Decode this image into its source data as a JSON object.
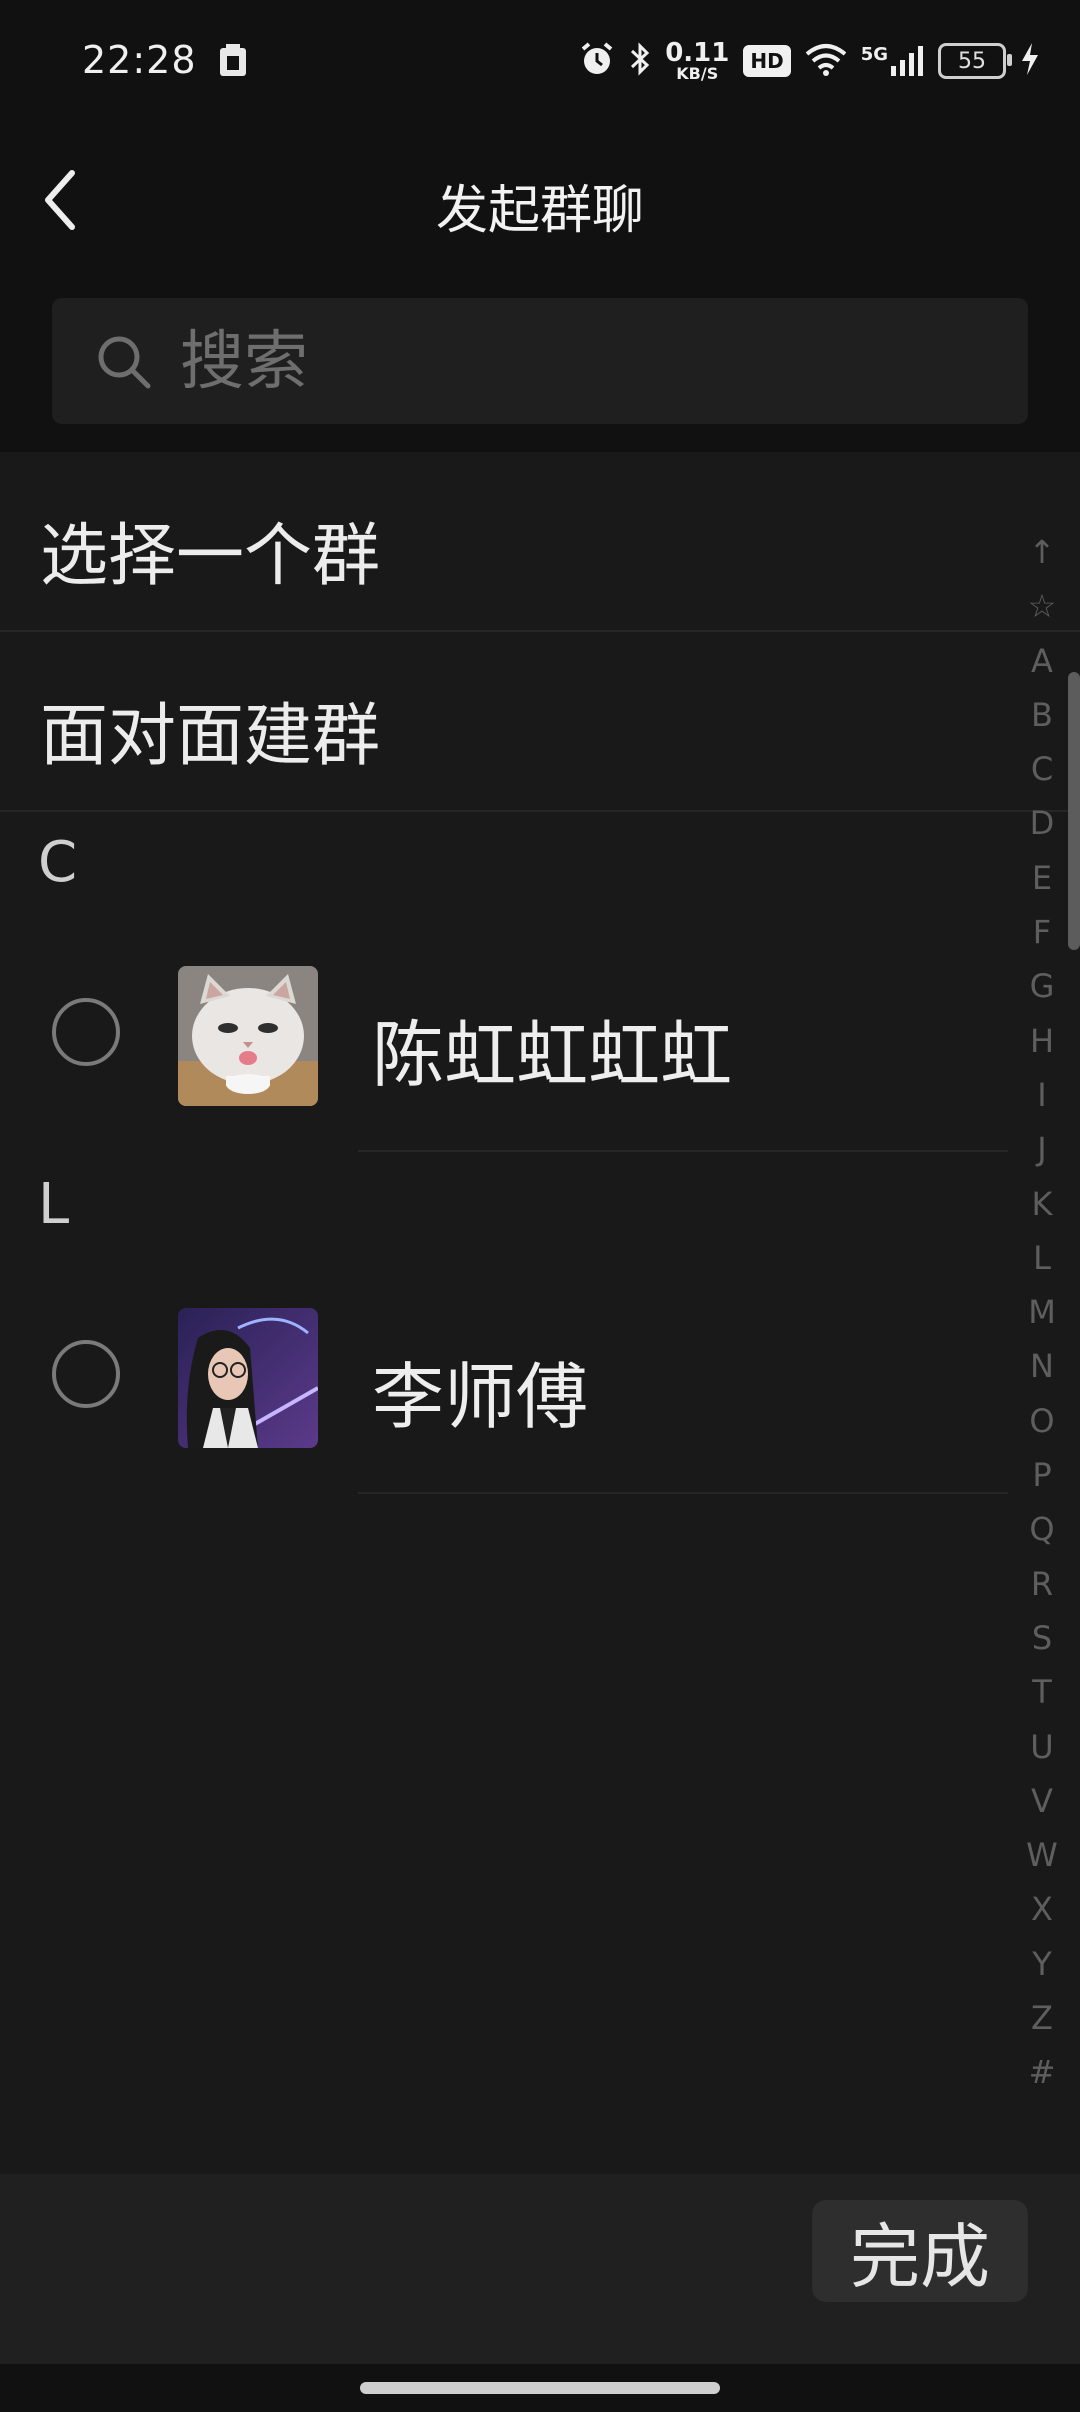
{
  "status_bar": {
    "time": "22:28",
    "net_speed_value": "0.11",
    "net_speed_unit": "KB/S",
    "hd_label": "HD",
    "network_type": "5G",
    "battery": "55",
    "icons": [
      "alarm-icon",
      "bluetooth-icon",
      "wifi-icon",
      "signal-icon",
      "charging-icon"
    ]
  },
  "header": {
    "title": "发起群聊",
    "back_icon": "chevron-left-icon"
  },
  "search": {
    "placeholder": "搜索",
    "value": ""
  },
  "options": [
    {
      "label": "选择一个群"
    },
    {
      "label": "面对面建群"
    }
  ],
  "sections": [
    {
      "letter": "C",
      "contacts": [
        {
          "name": "陈虹虹虹虹",
          "selected": false,
          "avatar": "cat-photo-avatar"
        }
      ]
    },
    {
      "letter": "L",
      "contacts": [
        {
          "name": "李师傅",
          "selected": false,
          "avatar": "girl-photo-avatar"
        }
      ]
    }
  ],
  "index_bar": [
    "↑",
    "☆",
    "A",
    "B",
    "C",
    "D",
    "E",
    "F",
    "G",
    "H",
    "I",
    "J",
    "K",
    "L",
    "M",
    "N",
    "O",
    "P",
    "Q",
    "R",
    "S",
    "T",
    "U",
    "V",
    "W",
    "X",
    "Y",
    "Z",
    "#"
  ],
  "footer": {
    "done_label": "完成"
  },
  "colors": {
    "background": "#111111",
    "list_background": "#191919",
    "divider": "#262626",
    "index_text": "#5e5e5e"
  }
}
